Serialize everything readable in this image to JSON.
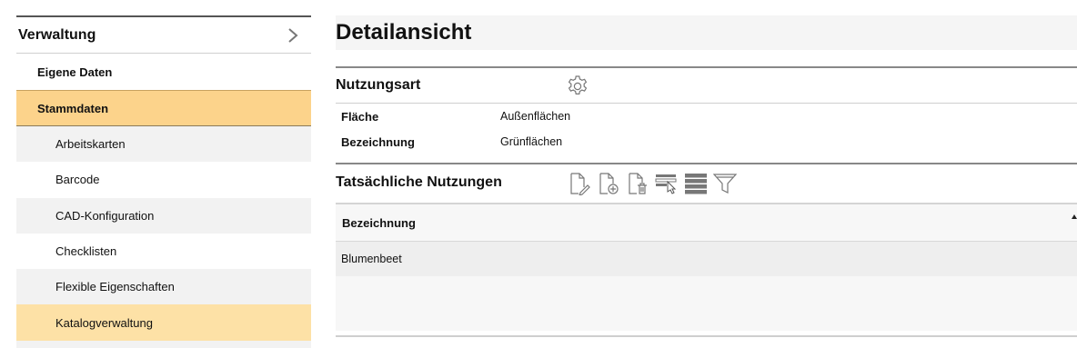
{
  "sidebar": {
    "header": "Verwaltung",
    "items": [
      {
        "label": "Eigene Daten"
      },
      {
        "label": "Stammdaten"
      },
      {
        "label": "Arbeitskarten"
      },
      {
        "label": "Barcode"
      },
      {
        "label": "CAD-Konfiguration"
      },
      {
        "label": "Checklisten"
      },
      {
        "label": "Flexible Eigenschaften"
      },
      {
        "label": "Katalogverwaltung"
      }
    ]
  },
  "main": {
    "title": "Detailansicht",
    "nutzungsart": {
      "title": "Nutzungsart",
      "fields": [
        {
          "label": "Fläche",
          "value": "Außenflächen"
        },
        {
          "label": "Bezeichnung",
          "value": "Grünflächen"
        }
      ]
    },
    "nutzungen": {
      "title": "Tatsächliche Nutzungen",
      "column": "Bezeichnung",
      "rows": [
        {
          "bezeichnung": "Blumenbeet"
        }
      ]
    }
  },
  "colors": {
    "active_item": "#fcd38b",
    "highlight_item": "#fde1a6",
    "row_grey": "#eeeeee"
  },
  "icons": {
    "header_chevron": "chevron-right-icon",
    "section_settings": "gear-icon",
    "toolbar": [
      "edit-document-icon",
      "add-document-icon",
      "delete-document-icon",
      "select-rows-icon",
      "list-rows-icon",
      "filter-icon"
    ]
  }
}
